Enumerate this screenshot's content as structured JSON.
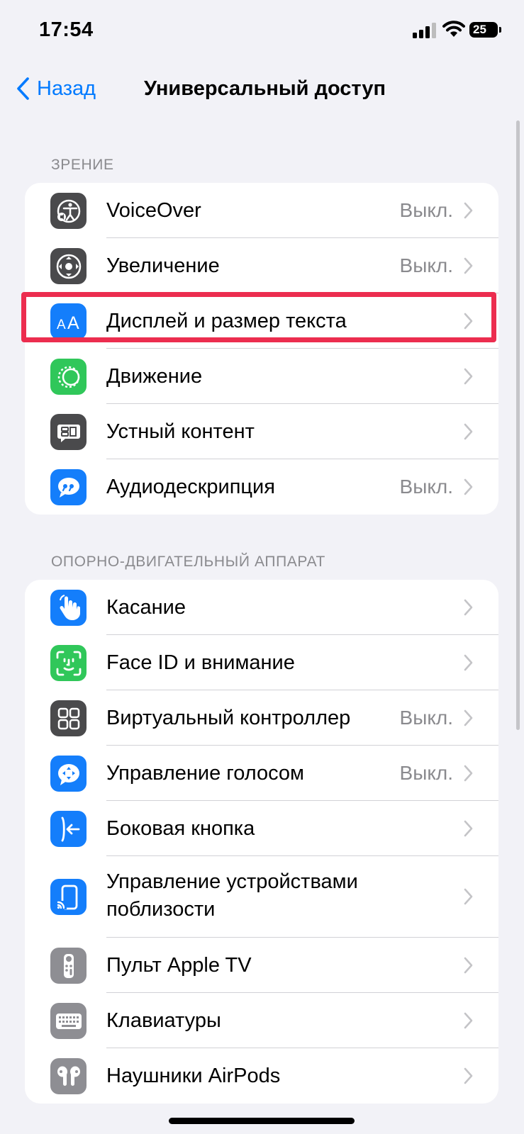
{
  "status_bar": {
    "time": "17:54",
    "battery": "25"
  },
  "nav": {
    "back_label": "Назад",
    "title": "Универсальный доступ"
  },
  "sections": [
    {
      "header": "ЗРЕНИЕ",
      "items": [
        {
          "label": "VoiceOver",
          "value": "Выкл.",
          "icon": "voiceover-icon",
          "icon_color": "#4a4a4c"
        },
        {
          "label": "Увеличение",
          "value": "Выкл.",
          "icon": "zoom-icon",
          "icon_color": "#4a4a4c"
        },
        {
          "label": "Дисплей и размер текста",
          "value": "",
          "icon": "display-text-size-icon",
          "icon_color": "#147efb",
          "highlighted": true
        },
        {
          "label": "Движение",
          "value": "",
          "icon": "motion-icon",
          "icon_color": "#30c75a"
        },
        {
          "label": "Устный контент",
          "value": "",
          "icon": "spoken-content-icon",
          "icon_color": "#4a4a4c"
        },
        {
          "label": "Аудиодескрипция",
          "value": "Выкл.",
          "icon": "audio-description-icon",
          "icon_color": "#147efb"
        }
      ]
    },
    {
      "header": "ОПОРНО-ДВИГАТЕЛЬНЫЙ АППАРАТ",
      "items": [
        {
          "label": "Касание",
          "value": "",
          "icon": "touch-icon",
          "icon_color": "#147efb"
        },
        {
          "label": "Face ID и внимание",
          "value": "",
          "icon": "face-id-icon",
          "icon_color": "#30c75a"
        },
        {
          "label": "Виртуальный контроллер",
          "value": "Выкл.",
          "icon": "switch-control-icon",
          "icon_color": "#4a4a4c"
        },
        {
          "label": "Управление голосом",
          "value": "Выкл.",
          "icon": "voice-control-icon",
          "icon_color": "#147efb"
        },
        {
          "label": "Боковая кнопка",
          "value": "",
          "icon": "side-button-icon",
          "icon_color": "#147efb"
        },
        {
          "label": "Управление устройствами поблизости",
          "value": "",
          "icon": "nearby-devices-icon",
          "icon_color": "#147efb"
        },
        {
          "label": "Пульт Apple TV",
          "value": "",
          "icon": "apple-tv-remote-icon",
          "icon_color": "#8e8e93"
        },
        {
          "label": "Клавиатуры",
          "value": "",
          "icon": "keyboard-icon",
          "icon_color": "#8e8e93"
        },
        {
          "label": "Наушники AirPods",
          "value": "",
          "icon": "airpods-icon",
          "icon_color": "#8e8e93"
        }
      ]
    }
  ]
}
